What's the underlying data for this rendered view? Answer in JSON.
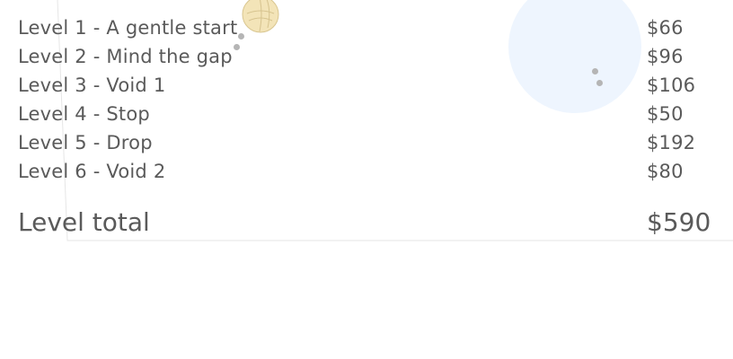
{
  "levels": [
    {
      "label": "Level 1 - A gentle start",
      "value": "$66"
    },
    {
      "label": "Level 2 - Mind the gap",
      "value": "$96"
    },
    {
      "label": "Level 3 - Void 1",
      "value": "$106"
    },
    {
      "label": "Level 4 - Stop",
      "value": "$50"
    },
    {
      "label": "Level 5 - Drop",
      "value": "$192"
    },
    {
      "label": "Level 6 - Void 2",
      "value": "$80"
    }
  ],
  "total": {
    "label": "Level total",
    "value": "$590"
  },
  "colors": {
    "text": "#5a5a5a",
    "bubble": "#eef5fe",
    "ball": "#f3e4b8",
    "edge": "#e6e6e6"
  }
}
